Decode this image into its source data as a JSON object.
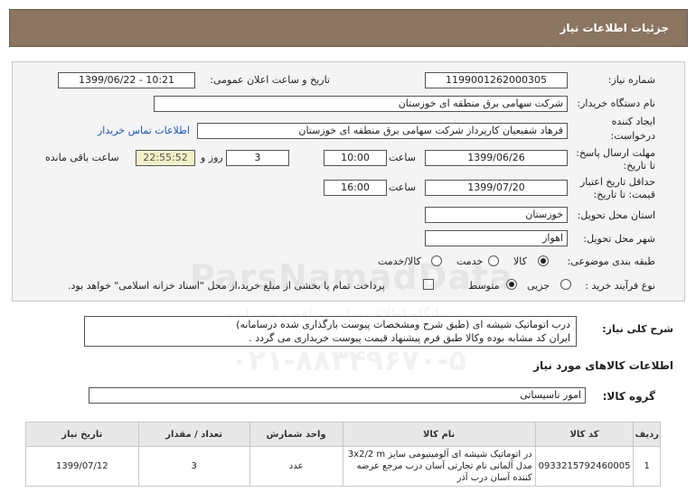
{
  "header": {
    "title": "جزئیات اطلاعات نیاز"
  },
  "form": {
    "need_number": {
      "label": "شماره نیاز:",
      "value": "1199001262000305"
    },
    "announce": {
      "label": "تاریخ و ساعت اعلان عمومی:",
      "value": "1399/06/22 - 10:21"
    },
    "buyer": {
      "label": "نام دستگاه خریدار:",
      "value": "شرکت سهامی برق منطقه ای خوزستان"
    },
    "creator": {
      "label1": "ایجاد کننده",
      "label2": "درخواست:",
      "value": "فرهاد شفیعیان کارپرداز شرکت سهامی برق منطقه ای خوزستان"
    },
    "contact_link": "اطلاعات تماس خریدار",
    "deadline": {
      "label1": "مهلت ارسال پاسخ:",
      "label2": "تا تاریخ:",
      "date": "1399/06/26",
      "time_label": "ساعت",
      "time": "10:00",
      "days": "3",
      "days_label": "روز و",
      "remaining": "22:55:52",
      "remaining_label": "ساعت باقی مانده"
    },
    "validity": {
      "label1": "حداقل تاریخ اعتبار",
      "label2": "قیمت: تا تاریخ:",
      "date": "1399/07/20",
      "time_label": "ساعت",
      "time": "16:00"
    },
    "province": {
      "label": "استان محل تحویل:",
      "value": "خوزستان"
    },
    "city": {
      "label": "شهر محل تحویل:",
      "value": "اهواز"
    },
    "category": {
      "label": "طبقه بندی موضوعی:",
      "options": [
        "کالا",
        "خدمت",
        "کالا/خدمت"
      ],
      "selected": "کالا"
    },
    "process": {
      "label": "نوع فرآیند خرید :",
      "options": [
        "جزیی",
        "متوسط"
      ],
      "selected": "متوسط",
      "payment_note": "پرداخت تمام یا بخشی از مبلغ خرید،از محل \"اسناد خزانه اسلامی\" خواهد بود."
    }
  },
  "description": {
    "label": "شرح کلی نیاز:",
    "lines": [
      "درب اتوماتیک شیشه ای (طبق شرح ومشخصات پیوست بارگذاری شده درسامانه)",
      "ایران کد مشابه بوده وکالا طبق فرم پیشنهاد قیمت پیوست خریداری می گردد ."
    ]
  },
  "watermark": {
    "brand": "ParsNamadData",
    "phone": "۰۲۱-۸۸۳۴۹۶۷۰-۵",
    "tagline": "پایگاه اطلاع رسانی مناقصه و مزایده"
  },
  "goods": {
    "section_title": "اطلاعات کالاهای مورد نیاز",
    "group_label": "گروه کالا:",
    "group_value": "امور تاسیساتی",
    "columns": [
      "ردیف",
      "کد کالا",
      "نام کالا",
      "واحد شمارش",
      "تعداد / مقدار",
      "تاریخ نیاز"
    ],
    "rows": [
      {
        "index": "1",
        "code": "0933215792460005",
        "name": "در اتوماتیک شیشه ای آلومینیومی سایز 3x2/2 m مدل آلمانی نام تجارتی آسان درب مرجع عرضه کننده آسان درب آذر",
        "unit": "عدد",
        "qty": "3",
        "date": "1399/07/12"
      }
    ]
  }
}
